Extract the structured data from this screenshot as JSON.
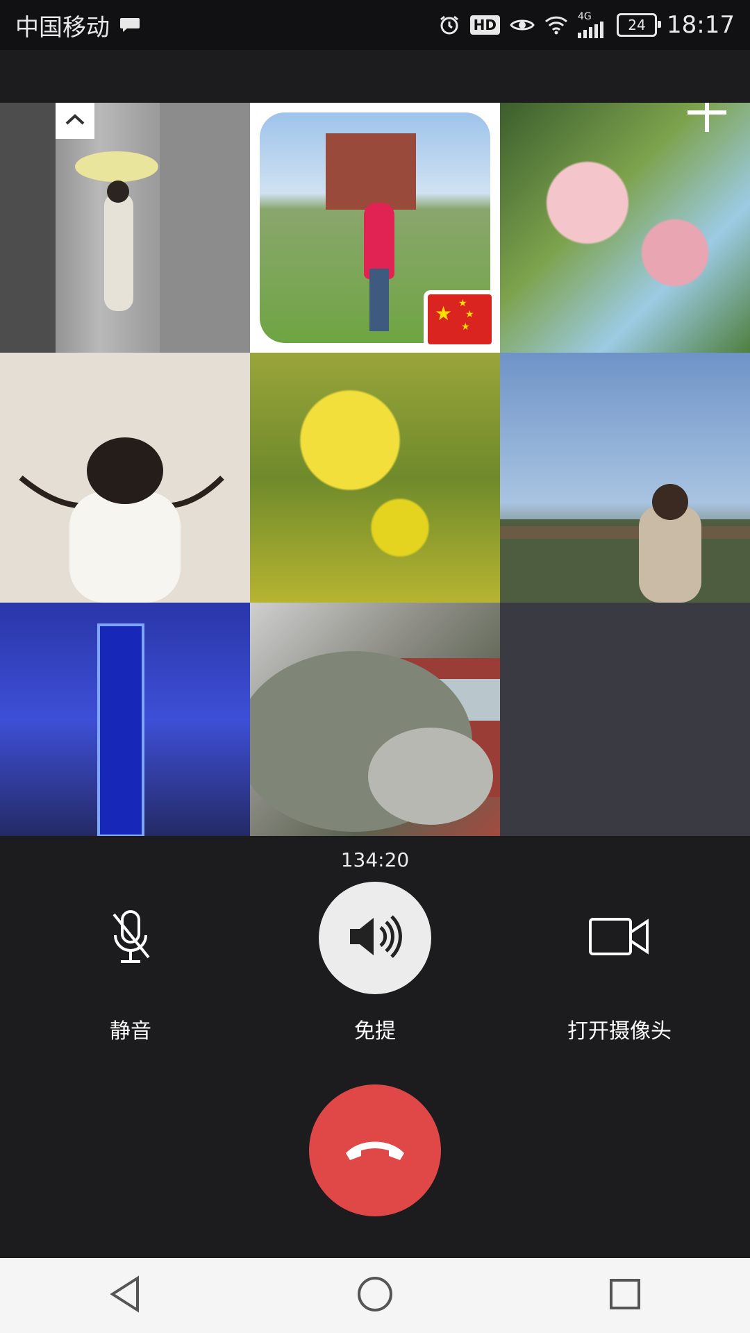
{
  "status_bar": {
    "carrier": "中国移动",
    "hd": "HD",
    "network": "4G",
    "battery": "24",
    "time": "18:17"
  },
  "grid": {
    "participants": [
      {
        "id": "tile-1"
      },
      {
        "id": "tile-2"
      },
      {
        "id": "tile-3"
      },
      {
        "id": "tile-4"
      },
      {
        "id": "tile-5"
      },
      {
        "id": "tile-6"
      },
      {
        "id": "tile-7"
      },
      {
        "id": "tile-8"
      },
      {
        "id": "tile-9-empty"
      }
    ]
  },
  "call": {
    "duration": "134:20",
    "mute_label": "静音",
    "speaker_label": "免提",
    "camera_label": "打开摄像头"
  },
  "colors": {
    "background": "#1c1c1e",
    "hangup": "#e04747",
    "speaker_active": "#ececec"
  },
  "icons": {
    "collapse": "chevron-up-icon",
    "add": "plus-icon",
    "mute": "microphone-muted-icon",
    "speaker": "speaker-icon",
    "camera": "video-camera-icon",
    "hangup": "phone-hangup-icon"
  }
}
